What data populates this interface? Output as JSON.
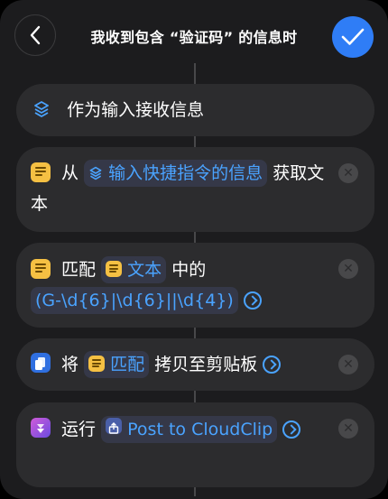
{
  "header": {
    "title": "我收到包含 “验证码” 的信息时"
  },
  "trigger": {
    "label": "作为输入接收信息"
  },
  "actions": [
    {
      "prefix": "从",
      "input_token": "输入快捷指令的信息",
      "suffix": "获取文本"
    },
    {
      "verb": "匹配",
      "text_token": "文本",
      "mid": "中的",
      "pattern": "(G-\\d{6}|\\d{6}||\\d{4})"
    },
    {
      "verb": "将",
      "match_token": "匹配",
      "suffix": "拷贝至剪贴板"
    },
    {
      "verb": "运行",
      "shortcut_token": "Post to CloudClip"
    }
  ],
  "colors": {
    "accent": "#2f7df6",
    "token_text": "#4aa3ff",
    "text_icon": "#f5c043"
  }
}
